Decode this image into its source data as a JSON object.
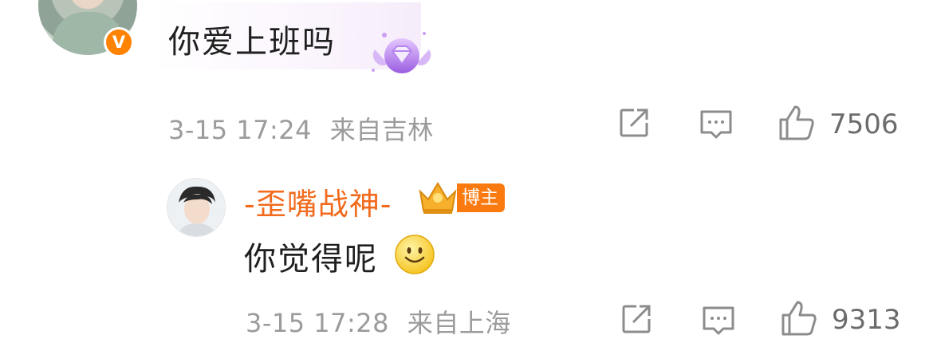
{
  "comment": {
    "text": "你爱上班吗",
    "date": "3-15 17:24",
    "location": "来自吉林",
    "verified_badge": "V",
    "like_count": "7506",
    "icons": [
      "share-icon",
      "reply-icon",
      "like-icon",
      "diamond-medal-icon"
    ]
  },
  "reply": {
    "username": "-歪嘴战神-",
    "author_tag": "博主",
    "text": "你觉得呢",
    "date": "3-15 17:28",
    "location": "来自上海",
    "like_count": "9313",
    "icons": [
      "crown-icon",
      "smiley-emoji-icon",
      "share-icon",
      "reply-icon",
      "like-icon"
    ]
  },
  "colors": {
    "username": "#f26b1d",
    "verified_badge": "#ff8200",
    "tag_bg": "#fa7a0f",
    "meta_text": "#9b9b9b",
    "icon_gray": "#8c8c8c"
  }
}
